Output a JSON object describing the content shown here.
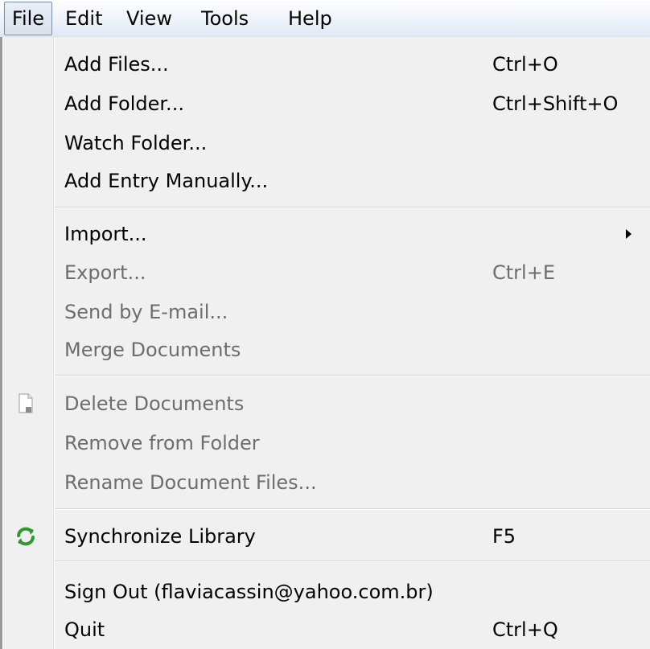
{
  "menubar": {
    "items": [
      {
        "label": "File"
      },
      {
        "label": "Edit"
      },
      {
        "label": "View"
      },
      {
        "label": "Tools"
      },
      {
        "label": "Help"
      }
    ]
  },
  "file_menu": {
    "items": [
      {
        "label": "Add Files...",
        "shortcut": "Ctrl+O",
        "enabled": true
      },
      {
        "label": "Add Folder...",
        "shortcut": "Ctrl+Shift+O",
        "enabled": true
      },
      {
        "label": "Watch Folder...",
        "shortcut": "",
        "enabled": true
      },
      {
        "label": "Add Entry Manually...",
        "shortcut": "",
        "enabled": true
      },
      {
        "label": "Import...",
        "shortcut": "",
        "enabled": true,
        "submenu": true
      },
      {
        "label": "Export...",
        "shortcut": "Ctrl+E",
        "enabled": false
      },
      {
        "label": "Send by E-mail...",
        "shortcut": "",
        "enabled": false
      },
      {
        "label": "Merge Documents",
        "shortcut": "",
        "enabled": false
      },
      {
        "label": "Delete Documents",
        "shortcut": "",
        "enabled": false,
        "icon": "document-icon"
      },
      {
        "label": "Remove from Folder",
        "shortcut": "",
        "enabled": false
      },
      {
        "label": "Rename Document Files...",
        "shortcut": "",
        "enabled": false
      },
      {
        "label": "Synchronize Library",
        "shortcut": "F5",
        "enabled": true,
        "icon": "sync-icon"
      },
      {
        "label": "Sign Out (flaviacassin@yahoo.com.br)",
        "shortcut": "",
        "enabled": true
      },
      {
        "label": "Quit",
        "shortcut": "Ctrl+Q",
        "enabled": true
      }
    ]
  },
  "colors": {
    "sync_icon": "#2e9a2e",
    "disabled_text": "#6d6d6d"
  }
}
